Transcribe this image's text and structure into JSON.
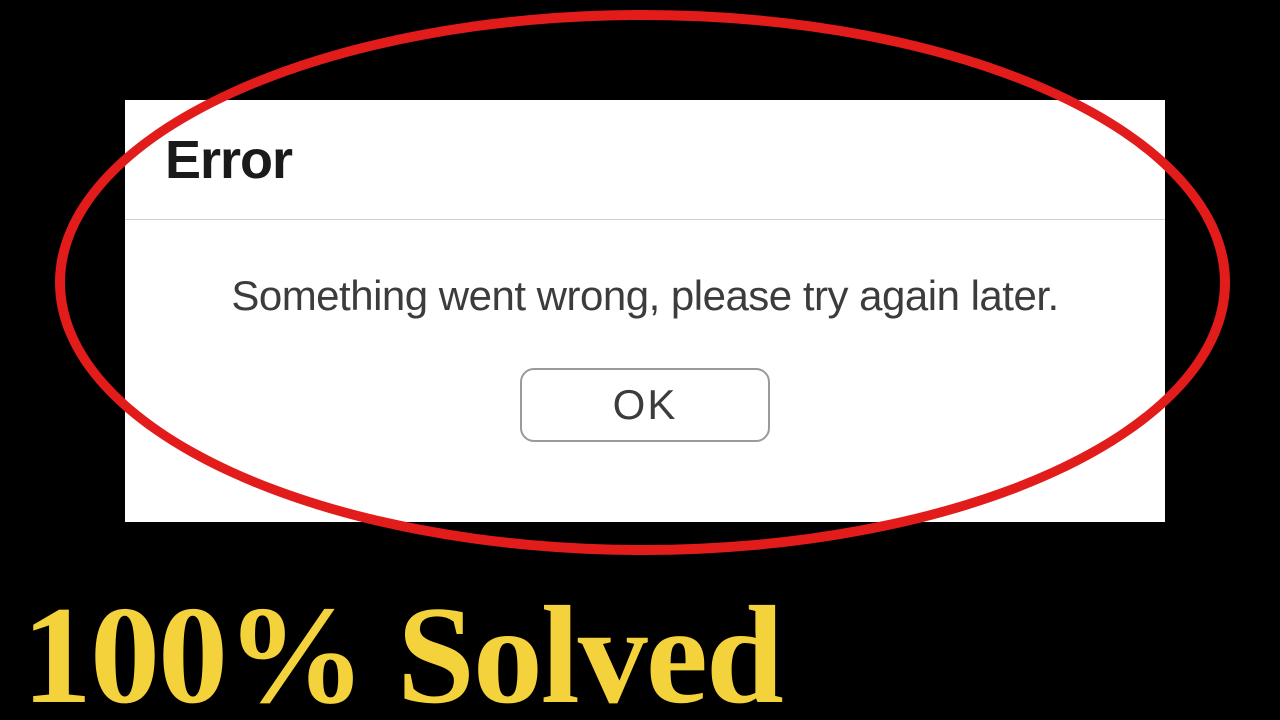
{
  "dialog": {
    "title": "Error",
    "message": "Something went wrong, please try again later.",
    "ok_label": "OK"
  },
  "caption": "100% Solved",
  "colors": {
    "annotation_ellipse": "#e21b1b",
    "caption_text": "#f4d23c",
    "background": "#000000",
    "dialog_bg": "#ffffff"
  }
}
